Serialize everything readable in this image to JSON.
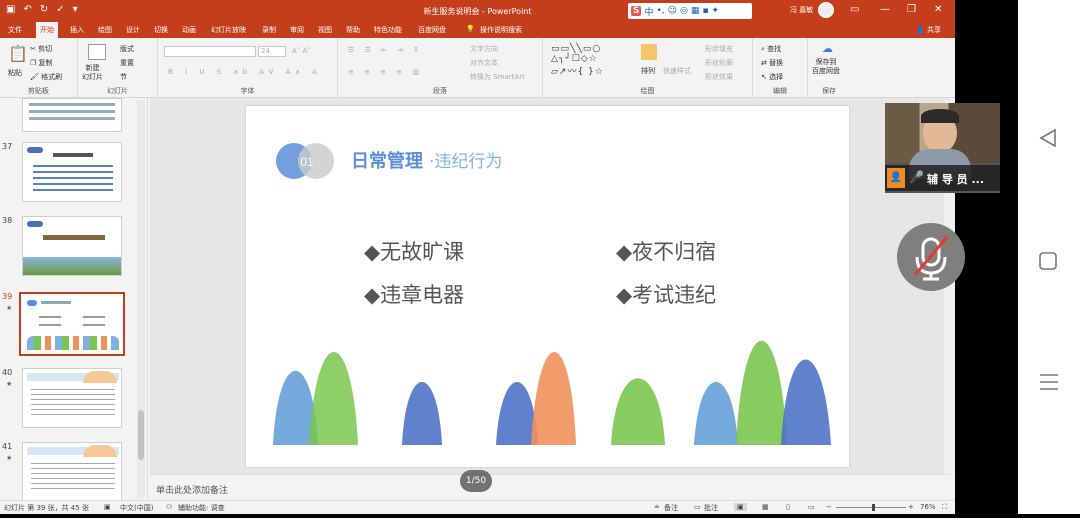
{
  "titlebar": {
    "doc_title": "新生服务说明会 - PowerPoint",
    "user_name": "冯 嘉敏"
  },
  "ime": {
    "logo": "S",
    "mode": "中"
  },
  "tabs": [
    {
      "label": "文件"
    },
    {
      "label": "开始"
    },
    {
      "label": "插入"
    },
    {
      "label": "绘图"
    },
    {
      "label": "设计"
    },
    {
      "label": "切换"
    },
    {
      "label": "动画"
    },
    {
      "label": "幻灯片放映"
    },
    {
      "label": "录制"
    },
    {
      "label": "审阅"
    },
    {
      "label": "视图"
    },
    {
      "label": "帮助"
    },
    {
      "label": "特色功能"
    },
    {
      "label": "百度网盘"
    },
    {
      "label": "操作说明搜索"
    }
  ],
  "share_label": "共享",
  "ribbon": {
    "clipboard": {
      "paste": "粘贴",
      "cut": "剪切",
      "copy": "复制",
      "format_painter": "格式刷",
      "label": "剪贴板"
    },
    "slides": {
      "new_slide": "新建\n幻灯片",
      "layout": "版式",
      "reset": "重置",
      "section": "节",
      "label": "幻灯片"
    },
    "font": {
      "label": "字体",
      "size": "24"
    },
    "paragraph": {
      "text_direction": "文字方向",
      "align_text": "对齐文本",
      "smartart": "转换为 SmartArt",
      "label": "段落"
    },
    "drawing": {
      "arrange": "排列",
      "quick_styles": "快速样式",
      "shape_fill": "形状填充",
      "shape_outline": "形状轮廓",
      "shape_effects": "形状效果",
      "label": "绘图"
    },
    "editing": {
      "find": "查找",
      "replace": "替换",
      "select": "选择",
      "label": "编辑"
    },
    "save": {
      "save_to_cloud": "保存到\n百度网盘",
      "label": "保存"
    }
  },
  "thumbnails": [
    {
      "number": "37",
      "star": ""
    },
    {
      "number": "38",
      "star": ""
    },
    {
      "number": "39",
      "star": "★"
    },
    {
      "number": "40",
      "star": "★"
    },
    {
      "number": "41",
      "star": "★"
    }
  ],
  "slide": {
    "badge_number": "01",
    "title_main": "日常管理",
    "title_sub": "·违纪行为",
    "items": [
      "◆无故旷课",
      "◆夜不归宿",
      "◆违章电器",
      "◆考试违纪"
    ]
  },
  "notes_placeholder": "单击此处添加备注",
  "pager": "1/50",
  "status": {
    "slide_info": "幻灯片 第 39 张，共 45 张",
    "language": "中文(中国)",
    "accessibility": "辅助功能: 调查",
    "notes_button": "备注",
    "comments_button": "批注",
    "zoom": "76%"
  },
  "video": {
    "caption": "辅 导 员 ..."
  },
  "colors": {
    "accent": "#c43e1c",
    "title_blue": "#5b8ed6",
    "bump_blue": "#4f74c8",
    "bump_green": "#7ac74f",
    "bump_orange": "#f0915a"
  }
}
